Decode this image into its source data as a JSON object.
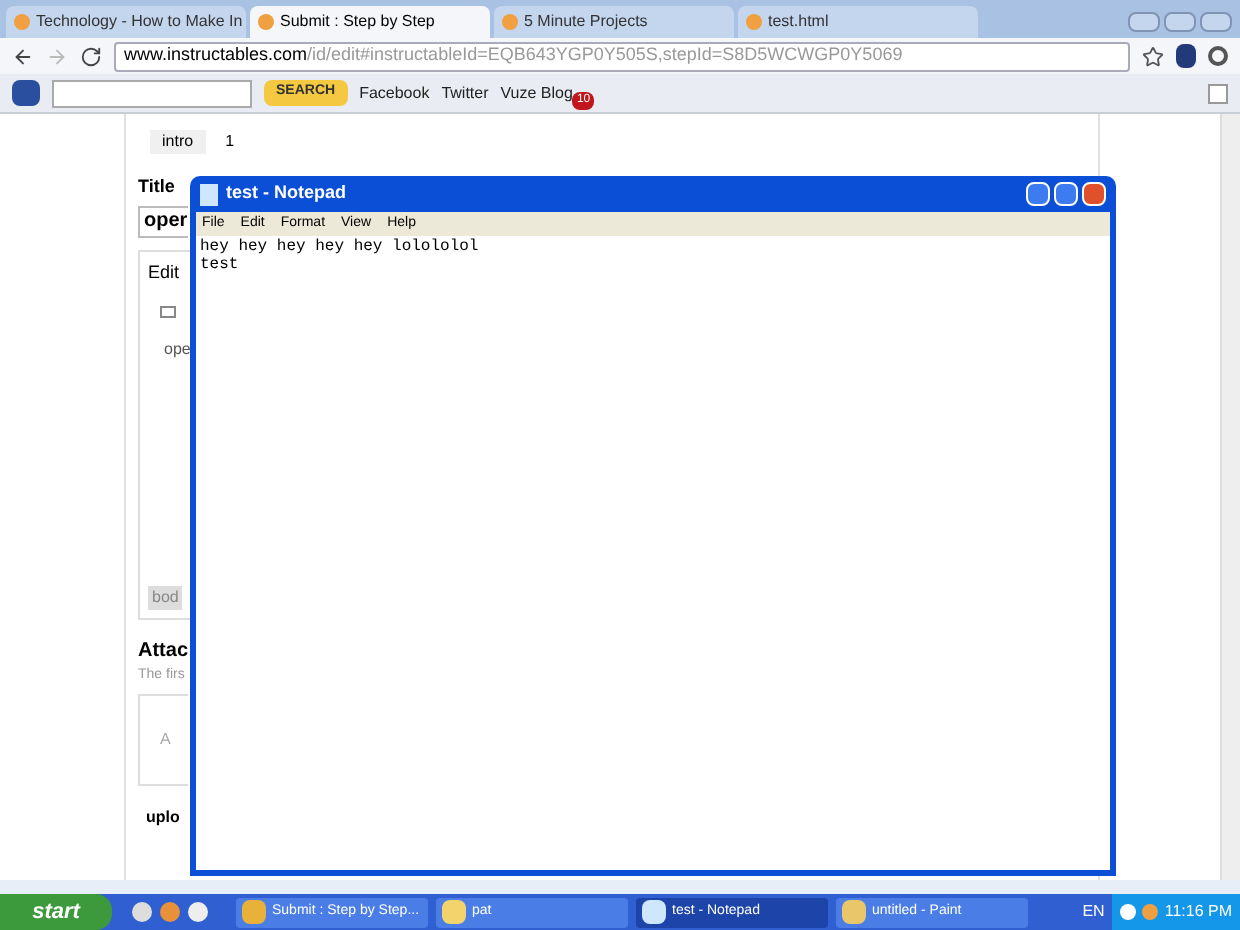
{
  "browser": {
    "tabs": [
      {
        "label": "Technology - How to Make In",
        "selected": false
      },
      {
        "label": "Submit : Step by Step",
        "selected": true
      },
      {
        "label": "5 Minute Projects",
        "selected": false
      },
      {
        "label": "test.html",
        "selected": false
      }
    ],
    "url": {
      "host": "www.instructables.com",
      "path": "/id/edit#instructableId=EQB643YGP0Y505S,stepId=S8D5WCWGP0Y5069"
    },
    "toolbar": {
      "search_button": "SEARCH",
      "links": [
        "Facebook",
        "Twitter",
        "Vuze Blog"
      ],
      "badge": "10"
    }
  },
  "page": {
    "step_tab": "intro",
    "step_number": "1",
    "title_label": "Title",
    "title_value": "oper",
    "editor_label": "Edit",
    "editor_text": "ope",
    "editor_footer": "bod",
    "attach_heading": "Attac",
    "attach_text": "The firs",
    "attach_drop": "A",
    "upload": "uplo"
  },
  "notepad": {
    "title": "test - Notepad",
    "menu": [
      "File",
      "Edit",
      "Format",
      "View",
      "Help"
    ],
    "lines": [
      "hey hey hey hey hey lolololol",
      "test"
    ]
  },
  "taskbar": {
    "start": "start",
    "tasks": [
      {
        "label": "Submit : Step by Step...",
        "kind": "browser",
        "selected": false
      },
      {
        "label": "pat",
        "kind": "folder",
        "selected": false
      },
      {
        "label": "test - Notepad",
        "kind": "notepad",
        "selected": true
      },
      {
        "label": "untitled - Paint",
        "kind": "paint",
        "selected": false
      }
    ],
    "language": "EN",
    "clock": "11:16 PM"
  }
}
